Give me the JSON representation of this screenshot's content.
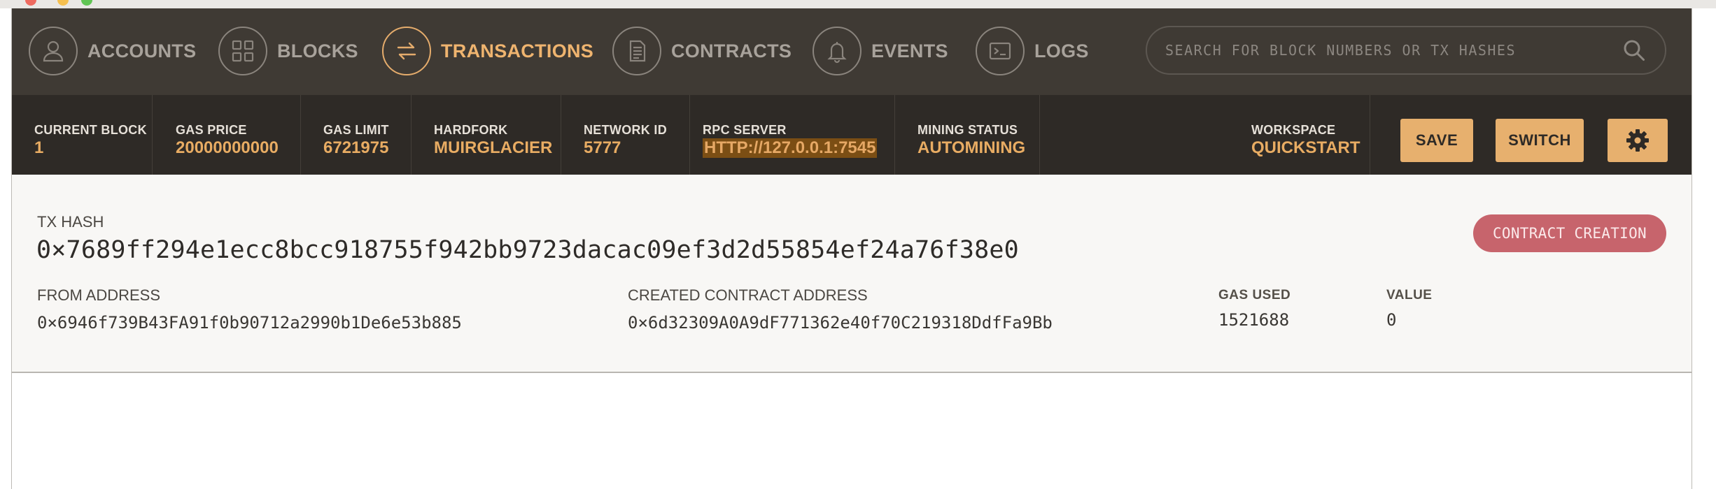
{
  "nav": {
    "items": [
      {
        "label": "ACCOUNTS",
        "icon": "person-icon",
        "active": false
      },
      {
        "label": "BLOCKS",
        "icon": "grid-icon",
        "active": false
      },
      {
        "label": "TRANSACTIONS",
        "icon": "swap-arrows-icon",
        "active": true
      },
      {
        "label": "CONTRACTS",
        "icon": "document-icon",
        "active": false
      },
      {
        "label": "EVENTS",
        "icon": "bell-icon",
        "active": false
      },
      {
        "label": "LOGS",
        "icon": "terminal-icon",
        "active": false
      }
    ],
    "search_placeholder": "SEARCH FOR BLOCK NUMBERS OR TX HASHES"
  },
  "status": {
    "current_block": {
      "label": "CURRENT BLOCK",
      "value": "1"
    },
    "gas_price": {
      "label": "GAS PRICE",
      "value": "20000000000"
    },
    "gas_limit": {
      "label": "GAS LIMIT",
      "value": "6721975"
    },
    "hardfork": {
      "label": "HARDFORK",
      "value": "MUIRGLACIER"
    },
    "network_id": {
      "label": "NETWORK ID",
      "value": "5777"
    },
    "rpc_server": {
      "label": "RPC SERVER",
      "value": "HTTP://127.0.0.1:7545"
    },
    "mining_status": {
      "label": "MINING STATUS",
      "value": "AUTOMINING"
    },
    "workspace": {
      "label": "WORKSPACE",
      "value": "QUICKSTART"
    },
    "save_label": "SAVE",
    "switch_label": "SWITCH",
    "settings_icon": "gear-icon"
  },
  "tx": {
    "hash_label": "TX HASH",
    "hash": "0×7689ff294e1ecc8bcc918755f942bb9723dacac09ef3d2d55854ef24a76f38e0",
    "badge": "CONTRACT CREATION",
    "from_label": "FROM ADDRESS",
    "from": "0×6946f739B43FA91f0b90712a2990b1De6e53b885",
    "contract_label": "CREATED CONTRACT ADDRESS",
    "contract": "0×6d32309A0A9dF771362e40f70C219318DdfFa9Bb",
    "gas_used_label": "GAS USED",
    "gas_used": "1521688",
    "value_label": "VALUE",
    "value": "0"
  },
  "colors": {
    "nav_bg": "#3f3a34",
    "status_bg": "#2e2a26",
    "accent": "#e8ac63",
    "badge": "#c7646c"
  }
}
